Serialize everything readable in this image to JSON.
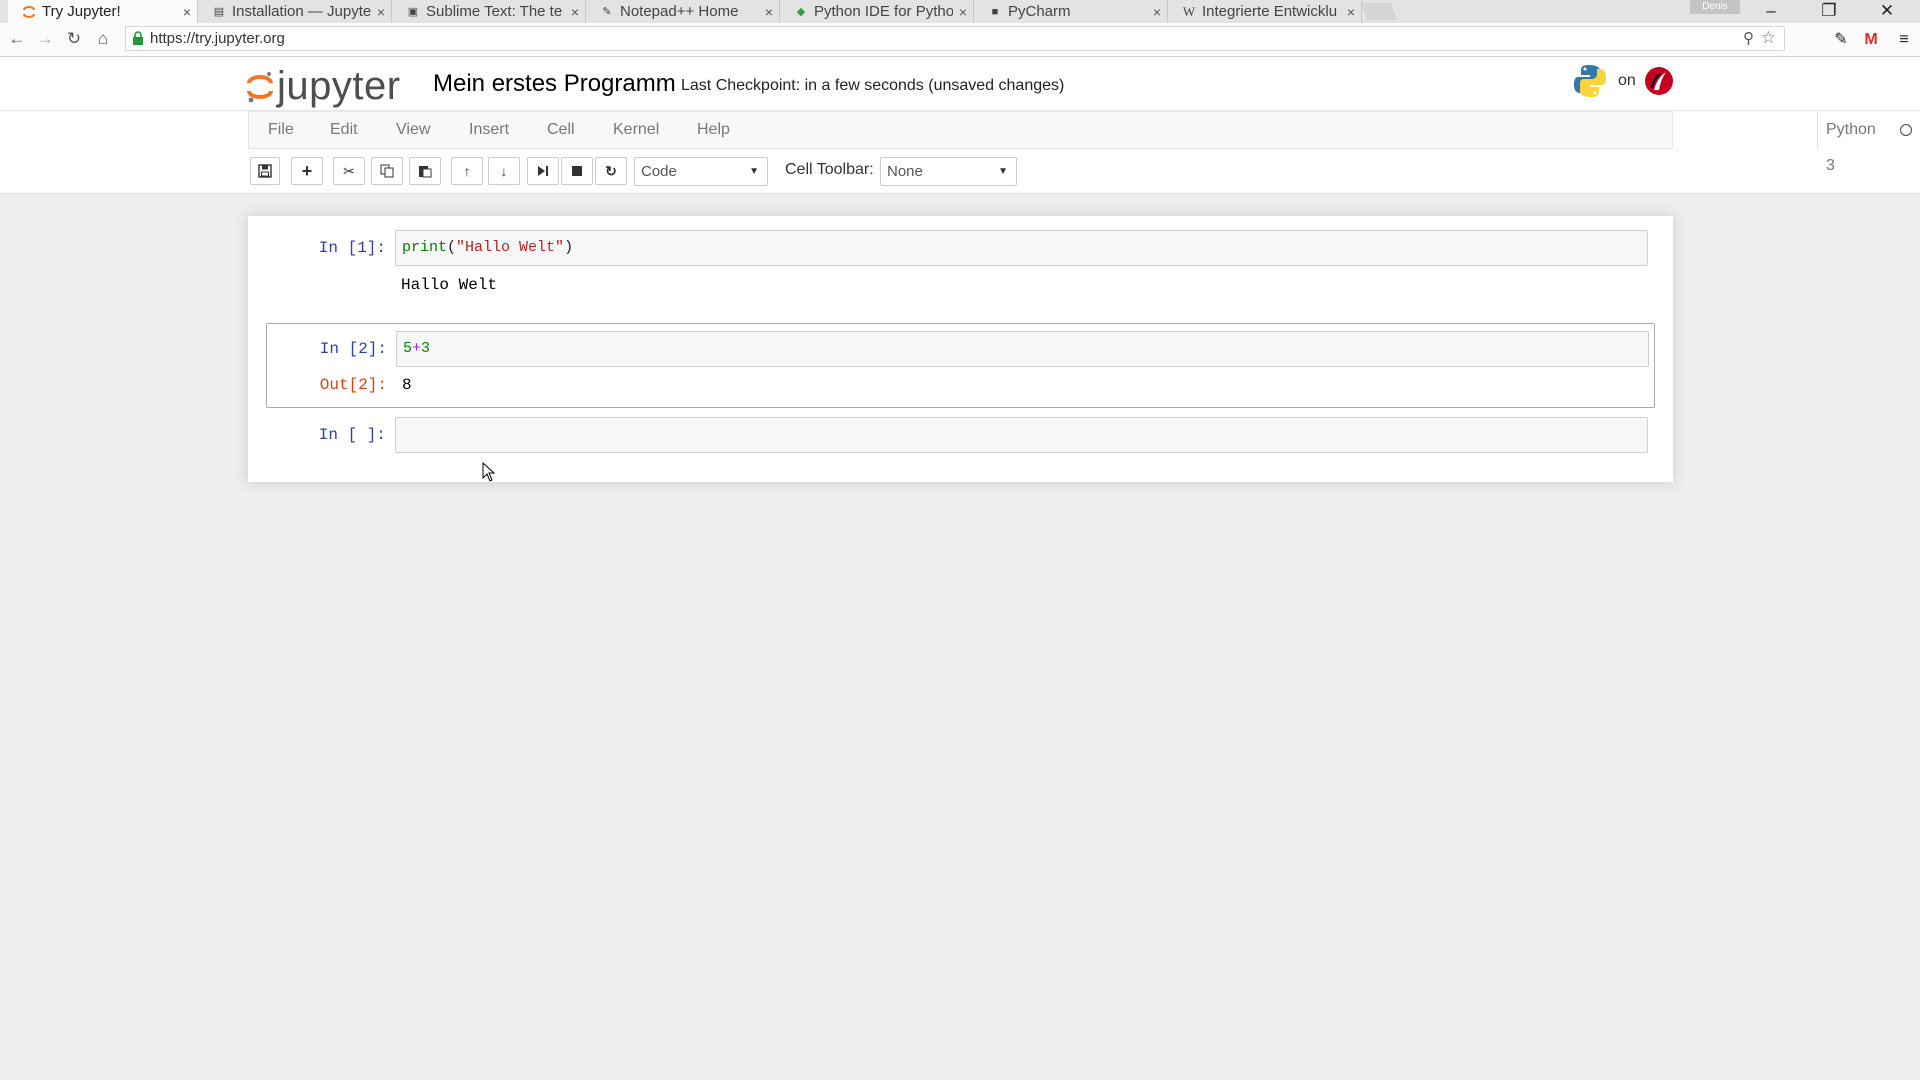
{
  "browser": {
    "tabs": [
      {
        "title": "Try Jupyter!",
        "icon": "jupyter-favicon",
        "active": true
      },
      {
        "title": "Installation — Jupyte",
        "icon": "doc-favicon"
      },
      {
        "title": "Sublime Text: The te",
        "icon": "sublime-favicon"
      },
      {
        "title": "Notepad++ Home",
        "icon": "notepad-favicon"
      },
      {
        "title": "Python IDE for Pytho",
        "icon": "pycharm-favicon"
      },
      {
        "title": "PyCharm",
        "icon": "pycharm-favicon"
      },
      {
        "title": "Integrierte Entwicklu",
        "icon": "wikipedia-favicon"
      }
    ],
    "tab_close": "×",
    "profile": "Denis",
    "url": "https://try.jupyter.org"
  },
  "jupyter": {
    "wordmark": "jupyter",
    "notebook_name": "Mein erstes Programm",
    "checkpoint": "Last Checkpoint: in a few seconds (unsaved changes)",
    "on_label": "on",
    "menu": [
      "File",
      "Edit",
      "View",
      "Insert",
      "Cell",
      "Kernel",
      "Help"
    ],
    "kernel": "Python 3",
    "cell_type": "Code",
    "cell_toolbar_label": "Cell Toolbar:",
    "cell_toolbar_value": "None"
  },
  "cells": [
    {
      "prompt": "In [1]:",
      "code": {
        "fn": "print",
        "open": "(",
        "str": "\"Hallo Welt\"",
        "close": ")"
      },
      "output": "Hallo Welt"
    },
    {
      "prompt": "In [2]:",
      "code": {
        "a": "5",
        "op": "+",
        "b": "3"
      },
      "out_prompt": "Out[2]:",
      "output": "8"
    },
    {
      "prompt": "In [ ]:"
    }
  ],
  "colors": {
    "accent": "#F37626",
    "in_prompt": "#303F9F",
    "out_prompt": "#D84315"
  }
}
